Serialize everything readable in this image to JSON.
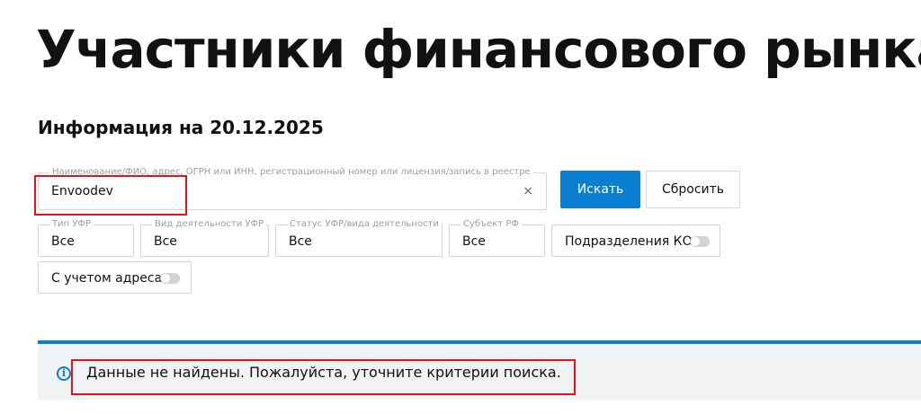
{
  "page": {
    "title": "Участники финансового рынка",
    "info_date": "Информация на 20.12.2025"
  },
  "search": {
    "label": "Наименование/ФИО, адрес, ОГРН или ИНН, регистрационный номер или лицензия/запись в реестре",
    "value": "Envoodev",
    "clear_symbol": "×"
  },
  "buttons": {
    "search_label": "Искать",
    "reset_label": "Сбросить"
  },
  "filters": [
    {
      "label": "Тип УФР",
      "value": "Все"
    },
    {
      "label": "Вид деятельности УФР",
      "value": "Все"
    },
    {
      "label": "Статус УФР/вида деятельности",
      "value": "Все"
    },
    {
      "label": "Субъект РФ",
      "value": "Все"
    }
  ],
  "toggles": [
    {
      "label": "Подразделения КО",
      "on": false
    },
    {
      "label": "С учетом адреса",
      "on": false
    }
  ],
  "result": {
    "icon": "info-icon",
    "message": "Данные не найдены. Пожалуйста, уточните критерии поиска."
  },
  "colors": {
    "accent": "#0a7fd1",
    "highlight": "#e0141e"
  }
}
